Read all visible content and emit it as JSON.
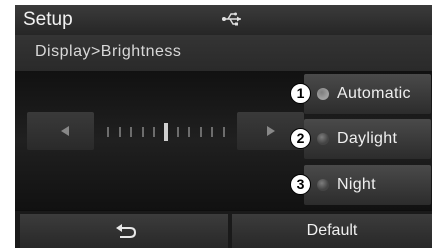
{
  "header": {
    "title": "Setup",
    "status_icon": "usb-icon"
  },
  "breadcrumb": "Display>Brightness",
  "slider": {
    "left_icon": "arrow-left-icon",
    "right_icon": "arrow-right-icon",
    "tick_count": 11,
    "level": 0.5
  },
  "modes": [
    {
      "number": "1",
      "label": "Automatic",
      "led_color": "#a0a0a0"
    },
    {
      "number": "2",
      "label": "Daylight",
      "led_color": "#444444"
    },
    {
      "number": "3",
      "label": "Night",
      "led_color": "#444444"
    }
  ],
  "bottom": {
    "back_icon": "return-arrow-icon",
    "default_label": "Default"
  }
}
